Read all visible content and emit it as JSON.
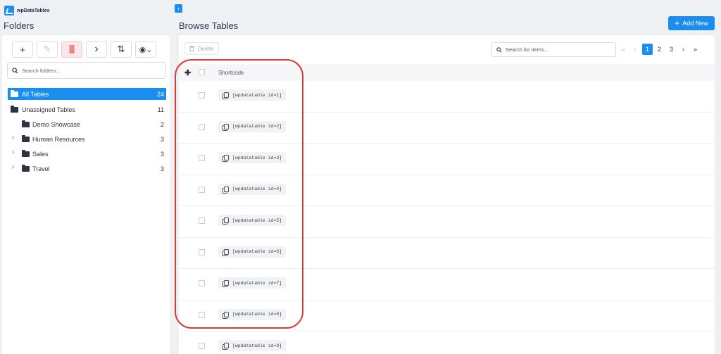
{
  "app": {
    "brand": "wpDataTables"
  },
  "folders": {
    "title": "Folders",
    "toolbar": [
      {
        "icon": "plus-icon",
        "glyph": "+"
      },
      {
        "icon": "edit-icon",
        "glyph": "✎"
      },
      {
        "icon": "trash-icon",
        "glyph": "🗑"
      },
      {
        "icon": "chevron-right-icon",
        "glyph": "›"
      },
      {
        "icon": "sort-icon",
        "glyph": "⇅"
      },
      {
        "icon": "eye-icon",
        "glyph": "◉⌄"
      }
    ],
    "search_placeholder": "Search folders...",
    "items": [
      {
        "label": "All Tables",
        "count": "24",
        "level": 0,
        "expandable": false,
        "active": true
      },
      {
        "label": "Unassigned Tables",
        "count": "11",
        "level": 0,
        "expandable": false,
        "active": false
      },
      {
        "label": "Demo Showcase",
        "count": "2",
        "level": 1,
        "expandable": false,
        "active": false
      },
      {
        "label": "Human Resources",
        "count": "3",
        "level": 1,
        "expandable": true,
        "active": false
      },
      {
        "label": "Sales",
        "count": "3",
        "level": 1,
        "expandable": true,
        "active": false
      },
      {
        "label": "Travel",
        "count": "3",
        "level": 1,
        "expandable": true,
        "active": false
      }
    ]
  },
  "main": {
    "title": "Browse Tables",
    "add_new_label": "Add New",
    "delete_label": "Delete",
    "search_placeholder": "Search for items...",
    "pagination": {
      "pages": [
        "1",
        "2",
        "3"
      ],
      "current": "1"
    },
    "columns": {
      "shortcode": "Shortcode"
    },
    "rows": [
      "[wpdatatable id=1]",
      "[wpdatatable id=2]",
      "[wpdatatable id=3]",
      "[wpdatatable id=4]",
      "[wpdatatable id=5]",
      "[wpdatatable id=6]",
      "[wpdatatable id=7]",
      "[wpdatatable id=8]",
      "[wpdatatable id=9]"
    ]
  },
  "colors": {
    "accent": "#1a8ef0",
    "highlight": "#d83a3a"
  }
}
